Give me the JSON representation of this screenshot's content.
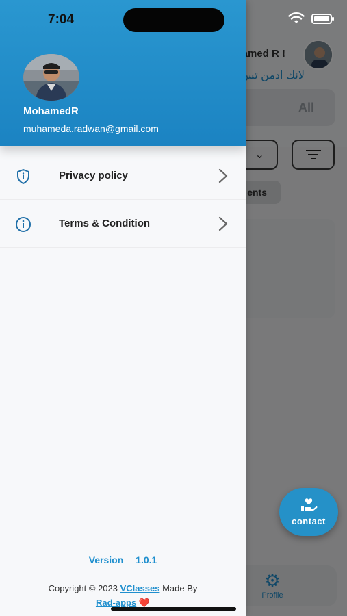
{
  "status_bar": {
    "time": "7:04"
  },
  "drawer": {
    "user": {
      "name": "MohamedR",
      "email": "muhameda.radwan@gmail.com"
    },
    "menu": [
      {
        "label": "Privacy policy",
        "icon": "shield-info-icon"
      },
      {
        "label": "Terms & Condition",
        "icon": "info-circle-icon"
      }
    ],
    "footer": {
      "version_label": "Version",
      "version_number": "1.0.1",
      "copyright_prefix": "Copyright © 2023",
      "company_link": "VClasses",
      "made_by_text": "Made By",
      "maker_link": "Rad-apps",
      "heart_icon": "❤️"
    }
  },
  "background_app": {
    "greeting": "amed R !",
    "subtitle": "لانك ادمن تس",
    "filter_all": "All",
    "chip_label": "ents",
    "tab_profile": "Profile",
    "contact_button": "contact"
  },
  "colors": {
    "accent": "#1f8fce",
    "header": "#2a97d0"
  }
}
